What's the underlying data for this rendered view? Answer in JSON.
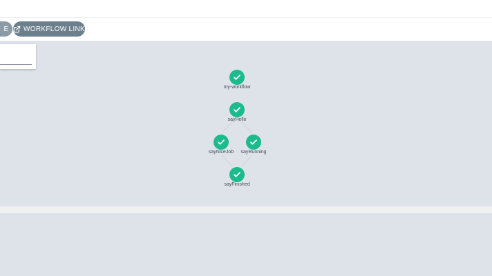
{
  "toolbar": {
    "partial_button_label": "E",
    "workflow_link_label": "WORKFLOW LINK",
    "workflow_link_icon": "external-link-icon"
  },
  "graph": {
    "nodes": [
      {
        "id": "my-workflow",
        "label": "my-workflow",
        "status": "success",
        "icon": "check-icon"
      },
      {
        "id": "sayHello",
        "label": "sayHello",
        "status": "success",
        "icon": "check-icon"
      },
      {
        "id": "sayNiceJob",
        "label": "sayNiceJob",
        "status": "success",
        "icon": "check-icon"
      },
      {
        "id": "sayRunning",
        "label": "sayRunning",
        "status": "success",
        "icon": "check-icon"
      },
      {
        "id": "sayFinished",
        "label": "sayFinished",
        "status": "success",
        "icon": "check-icon"
      }
    ],
    "edges": [
      [
        "sayHello",
        "sayNiceJob"
      ],
      [
        "sayHello",
        "sayRunning"
      ],
      [
        "sayNiceJob",
        "sayFinished"
      ],
      [
        "sayRunning",
        "sayFinished"
      ]
    ]
  },
  "colors": {
    "success": "#1cbb8c",
    "canvas": "#dee3ea",
    "button": "#6b7f8c"
  }
}
